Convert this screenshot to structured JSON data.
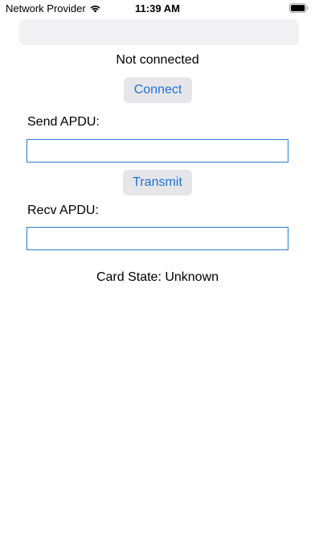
{
  "status_bar": {
    "carrier": "Network Provider",
    "time": "11:39 AM",
    "wifi_icon": "wifi-icon",
    "battery_icon": "battery-full-icon"
  },
  "top_field": {
    "value": "",
    "placeholder": ""
  },
  "connection": {
    "status": "Not connected",
    "connect_label": "Connect"
  },
  "send": {
    "label": "Send APDU:",
    "value": "",
    "placeholder": ""
  },
  "transmit": {
    "label": "Transmit"
  },
  "recv": {
    "label": "Recv APDU:",
    "value": "",
    "placeholder": ""
  },
  "card_state": "Card State: Unknown",
  "colors": {
    "accent": "#1a73d9",
    "input_border": "#2b7ad8",
    "button_bg": "#e6e6ea",
    "field_bg": "#f2f2f4"
  }
}
